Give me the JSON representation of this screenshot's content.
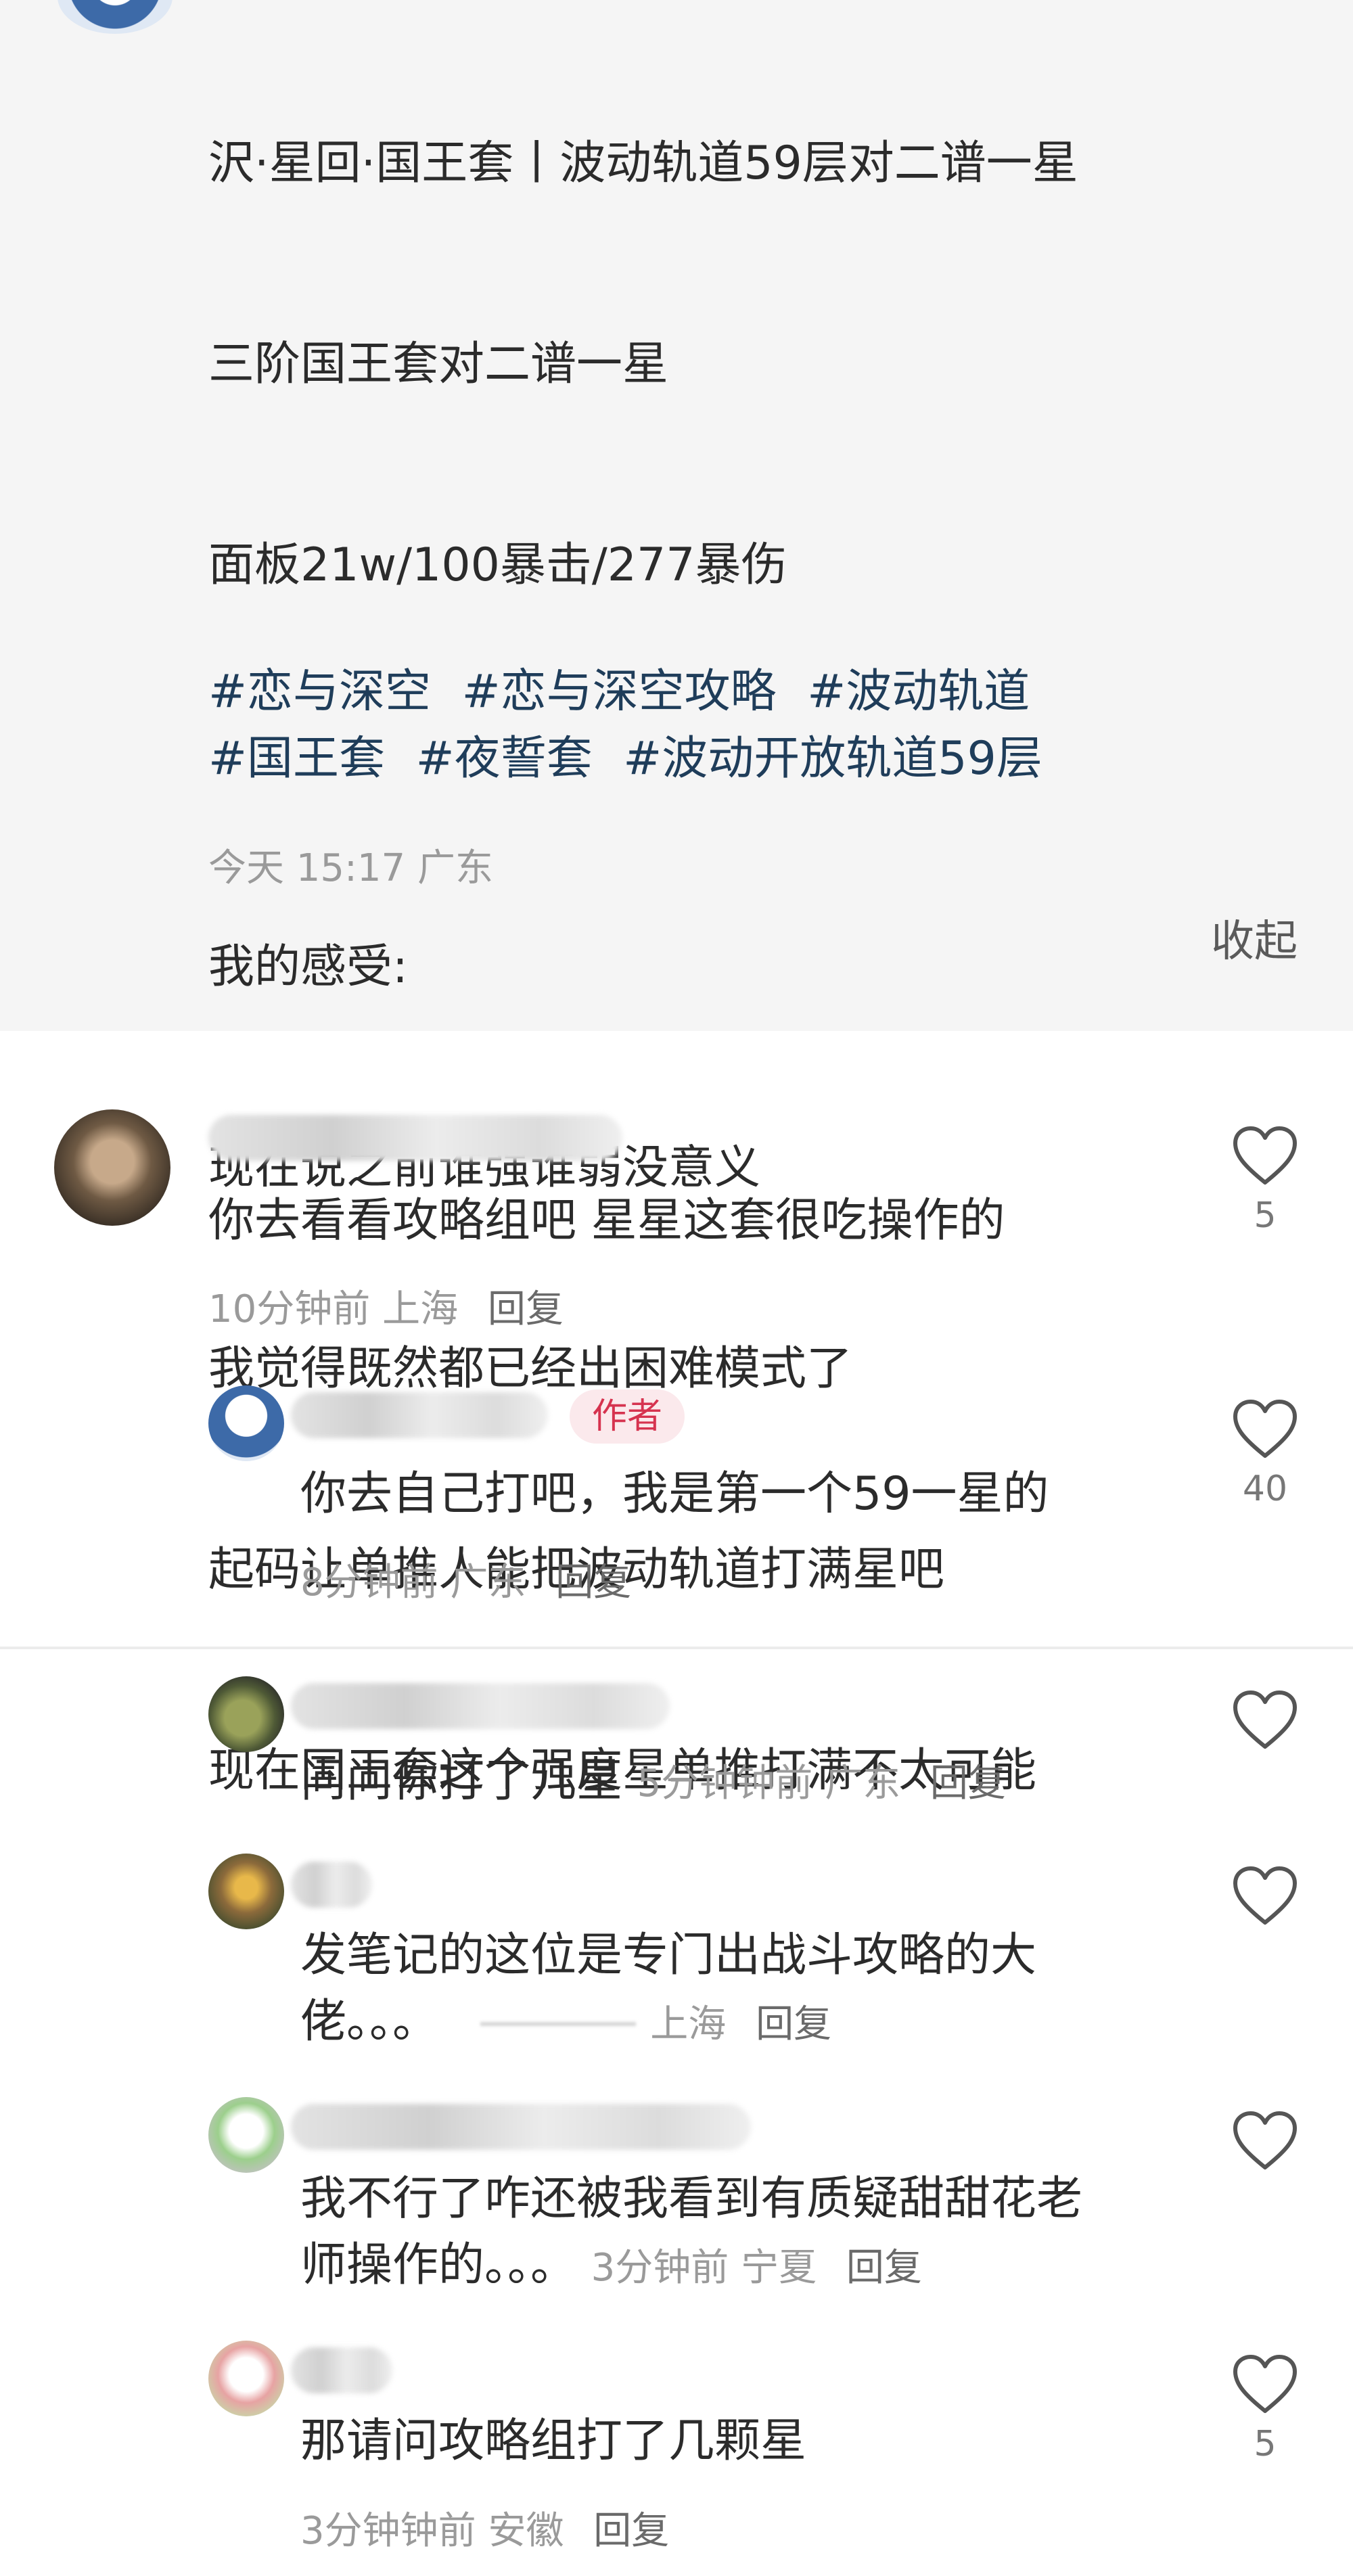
{
  "post": {
    "lines": [
      "沢·星回·国王套丨波动轨道59层对二谱一星",
      "三阶国王套对二谱一星",
      "面板21w/100暴击/277暴伤",
      "",
      "我的感受:",
      "现在说之前谁强谁弱没意义",
      "我觉得既然都已经出困难模式了",
      "起码让单推人能把波动轨道打满星吧",
      "现在国王套这个强度星单推打满不太可能"
    ],
    "tags": [
      "#恋与深空",
      "#恋与深空攻略",
      "#波动轨道",
      "#国王套",
      "#夜誓套",
      "#波动开放轨道59层"
    ],
    "meta": "今天 15:17 广东",
    "collapse_label": "收起"
  },
  "comments": [
    {
      "text": "你去看看攻略组吧 星星这套很吃操作的",
      "time": "10分钟前",
      "location": "上海",
      "reply": "回复",
      "likes": "5"
    },
    {
      "badge": "作者",
      "text": "你去自己打吧，我是第一个59一星的",
      "time": "8分钟前",
      "location": "广东",
      "reply": "回复",
      "likes": "40"
    },
    {
      "text": "问问你打了几星",
      "time": "5分钟钟前",
      "location": "广东",
      "reply": "回复"
    },
    {
      "text_lines": [
        "发笔记的这位是专门出战斗攻略的大",
        "佬。。。"
      ],
      "location": "上海",
      "reply": "回复"
    },
    {
      "text_lines": [
        "我不行了咋还被我看到有质疑甜甜花老",
        "师操作的。。。"
      ],
      "time": "3分钟前",
      "location": "宁夏",
      "reply": "回复"
    },
    {
      "text": "那请问攻略组打了几颗星",
      "time": "3分钟钟前",
      "location": "安徽",
      "reply": "回复",
      "likes": "5"
    }
  ],
  "icons": {
    "like": "heart-outline-icon"
  },
  "colors": {
    "tag": "#1f3d5a",
    "badge_bg": "#fbe9ec",
    "badge_text": "#d6334f",
    "post_bg": "#f5f5f5"
  }
}
